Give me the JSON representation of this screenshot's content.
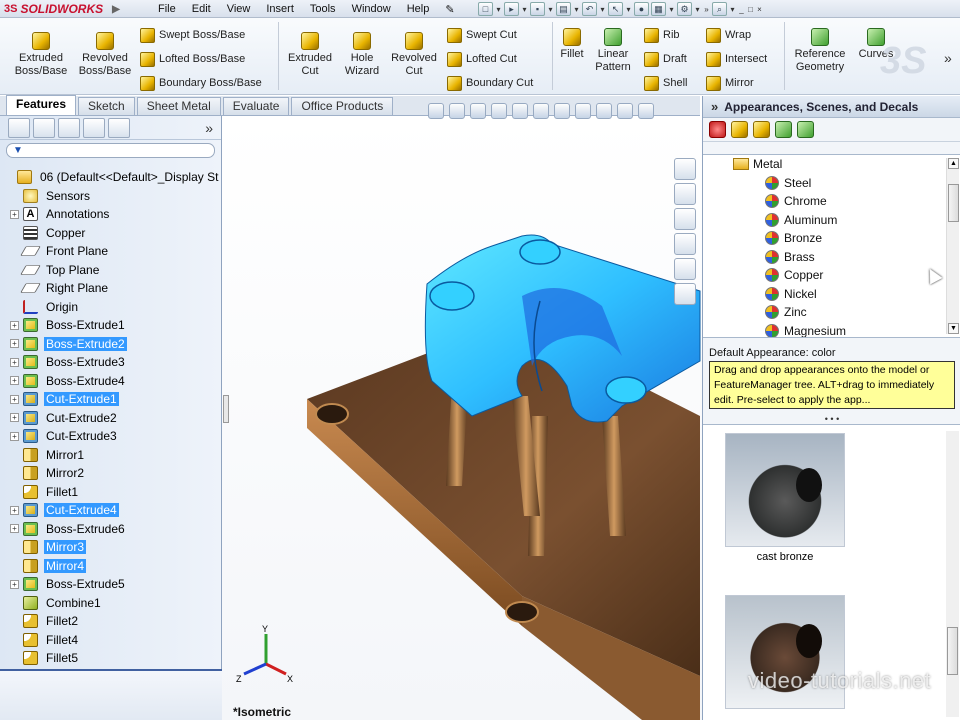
{
  "app": {
    "brand": "SOLIDWORKS",
    "brand_prefix": "3S"
  },
  "menus": [
    "File",
    "Edit",
    "View",
    "Insert",
    "Tools",
    "Window",
    "Help"
  ],
  "features_group1": [
    {
      "label1": "Extruded",
      "label2": "Boss/Base"
    },
    {
      "label1": "Revolved",
      "label2": "Boss/Base"
    }
  ],
  "features_small1": [
    "Swept Boss/Base",
    "Lofted Boss/Base",
    "Boundary Boss/Base"
  ],
  "features_group2": [
    {
      "label1": "Extruded",
      "label2": "Cut"
    },
    {
      "label1": "Hole",
      "label2": "Wizard"
    },
    {
      "label1": "Revolved",
      "label2": "Cut"
    }
  ],
  "features_small2": [
    "Swept Cut",
    "Lofted Cut",
    "Boundary Cut"
  ],
  "features_group3": {
    "fillet": "Fillet",
    "linear_pattern1": "Linear",
    "linear_pattern2": "Pattern",
    "small_a": [
      "Rib",
      "Draft",
      "Shell"
    ],
    "small_b": [
      "Wrap",
      "Intersect",
      "Mirror"
    ],
    "refgeo1": "Reference",
    "refgeo2": "Geometry",
    "curves": "Curves"
  },
  "tabs": [
    "Features",
    "Sketch",
    "Sheet Metal",
    "Evaluate",
    "Office Products"
  ],
  "feature_tree": [
    {
      "label": "06  (Default<<Default>_Display St",
      "icon": "part-icon",
      "exp": "",
      "sel": false
    },
    {
      "label": "Sensors",
      "icon": "sensors-icon",
      "exp": "none",
      "sel": false
    },
    {
      "label": "Annotations",
      "icon": "annotations-icon",
      "exp": "+",
      "sel": false
    },
    {
      "label": "Copper",
      "icon": "material-icon",
      "exp": "none",
      "sel": false
    },
    {
      "label": "Front Plane",
      "icon": "plane-icon",
      "exp": "none",
      "sel": false
    },
    {
      "label": "Top Plane",
      "icon": "plane-icon",
      "exp": "none",
      "sel": false
    },
    {
      "label": "Right Plane",
      "icon": "plane-icon",
      "exp": "none",
      "sel": false
    },
    {
      "label": "Origin",
      "icon": "origin-icon",
      "exp": "none",
      "sel": false
    },
    {
      "label": "Boss-Extrude1",
      "icon": "boss-extrude-icon",
      "exp": "+",
      "sel": false
    },
    {
      "label": "Boss-Extrude2",
      "icon": "boss-extrude-icon",
      "exp": "+",
      "sel": true
    },
    {
      "label": "Boss-Extrude3",
      "icon": "boss-extrude-icon",
      "exp": "+",
      "sel": false
    },
    {
      "label": "Boss-Extrude4",
      "icon": "boss-extrude-icon",
      "exp": "+",
      "sel": false
    },
    {
      "label": "Cut-Extrude1",
      "icon": "cut-extrude-icon",
      "exp": "+",
      "sel": true
    },
    {
      "label": "Cut-Extrude2",
      "icon": "cut-extrude-icon",
      "exp": "+",
      "sel": false
    },
    {
      "label": "Cut-Extrude3",
      "icon": "cut-extrude-icon",
      "exp": "+",
      "sel": false
    },
    {
      "label": "Mirror1",
      "icon": "mirror-icon",
      "exp": "none",
      "sel": false
    },
    {
      "label": "Mirror2",
      "icon": "mirror-icon",
      "exp": "none",
      "sel": false
    },
    {
      "label": "Fillet1",
      "icon": "fillet-icon",
      "exp": "none",
      "sel": false
    },
    {
      "label": "Cut-Extrude4",
      "icon": "cut-extrude-icon",
      "exp": "+",
      "sel": true
    },
    {
      "label": "Boss-Extrude6",
      "icon": "boss-extrude-icon",
      "exp": "+",
      "sel": false
    },
    {
      "label": "Mirror3",
      "icon": "mirror-icon",
      "exp": "none",
      "sel": true
    },
    {
      "label": "Mirror4",
      "icon": "mirror-icon",
      "exp": "none",
      "sel": true
    },
    {
      "label": "Boss-Extrude5",
      "icon": "boss-extrude-icon",
      "exp": "+",
      "sel": false
    },
    {
      "label": "Combine1",
      "icon": "combine-icon",
      "exp": "none",
      "sel": false
    },
    {
      "label": "Fillet2",
      "icon": "fillet-icon",
      "exp": "none",
      "sel": false
    },
    {
      "label": "Fillet4",
      "icon": "fillet-icon",
      "exp": "none",
      "sel": false
    },
    {
      "label": "Fillet5",
      "icon": "fillet-icon",
      "exp": "none",
      "sel": false
    }
  ],
  "viewport": {
    "view_label": "*Isometric",
    "axes": [
      "Y",
      "X",
      "Z"
    ]
  },
  "task_pane": {
    "title": "Appearances, Scenes, and Decals",
    "folder": "Metal",
    "items": [
      "Steel",
      "Chrome",
      "Aluminum",
      "Bronze",
      "Brass",
      "Copper",
      "Nickel",
      "Zinc",
      "Magnesium"
    ],
    "default_appearance": "Default Appearance: color",
    "tooltip": "Drag and drop appearances onto the model or FeatureManager tree.  ALT+drag to immediately edit.  Pre-select to apply the app...",
    "swatches": [
      "cast bronze"
    ]
  },
  "watermark": "video-tutorials.net",
  "colors": {
    "selection": "#3399ff",
    "selected_face": "#33d6ff",
    "part_body": "#8a5a30",
    "tooltip_bg": "#ffff99"
  }
}
